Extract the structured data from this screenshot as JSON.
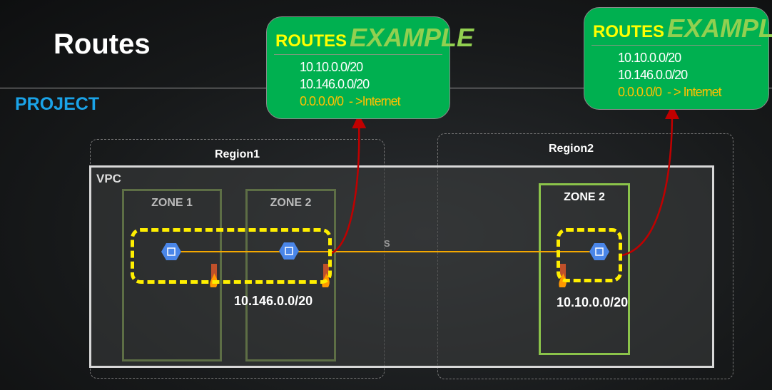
{
  "slide": {
    "title": "Routes",
    "project_label": "PROJECT"
  },
  "regions": [
    {
      "label": "Region1"
    },
    {
      "label": "Region2"
    }
  ],
  "vpc": {
    "label": "VPC"
  },
  "zones": [
    {
      "label": "ZONE 1"
    },
    {
      "label": "ZONE 2"
    },
    {
      "label": "ZONE 2"
    }
  ],
  "subnets": [
    {
      "cidr": "10.146.0.0/20"
    },
    {
      "cidr": "10.10.0.0/20"
    }
  ],
  "marker": "S",
  "route_tables": [
    {
      "heading": "ROUTES",
      "subheading": "EXAMPLE",
      "routes": [
        "10.10.0.0/20",
        "10.146.0.0/20"
      ],
      "default_route": "0.0.0.0/0  - >Internet"
    },
    {
      "heading": "ROUTES",
      "subheading": "EXAMPLE",
      "routes": [
        "10.10.0.0/20",
        "10.146.0.0/20"
      ],
      "default_route": "0.0.0.0/0  - > Internet"
    }
  ],
  "colors": {
    "project": "#1aa3e8",
    "routes_box": "#00b050",
    "subnet_outline": "#ffef00",
    "vpn_line": "#f5a800",
    "arrow": "#c00000",
    "vm_icon": "#4a86e8"
  }
}
